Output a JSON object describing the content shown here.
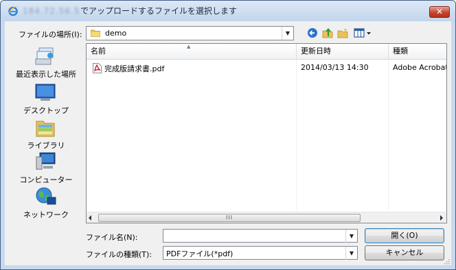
{
  "window": {
    "host_blurred": "184.72.56.5",
    "title": "でアップロードするファイルを選択します",
    "close_label": "✕"
  },
  "lookin": {
    "label": "ファイルの場所(I):",
    "value": "demo"
  },
  "places": [
    {
      "label": "最近表示した場所",
      "icon": "recent-places-icon"
    },
    {
      "label": "デスクトップ",
      "icon": "desktop-icon"
    },
    {
      "label": "ライブラリ",
      "icon": "libraries-icon"
    },
    {
      "label": "コンピューター",
      "icon": "computer-icon"
    },
    {
      "label": "ネットワーク",
      "icon": "network-icon"
    }
  ],
  "columns": [
    "名前",
    "更新日時",
    "種類"
  ],
  "files": [
    {
      "name": "完成版請求書.pdf",
      "modified": "2014/03/13 14:30",
      "type": "Adobe Acrobat"
    }
  ],
  "scrollbar": {
    "thumb_grip": "III"
  },
  "bottom": {
    "filename_label": "ファイル名(N):",
    "filename_value": "",
    "filetype_label": "ファイルの種類(T):",
    "filetype_value": "PDFファイル(*pdf)",
    "open_label": "開く(O)",
    "cancel_label": "キャンセル"
  }
}
